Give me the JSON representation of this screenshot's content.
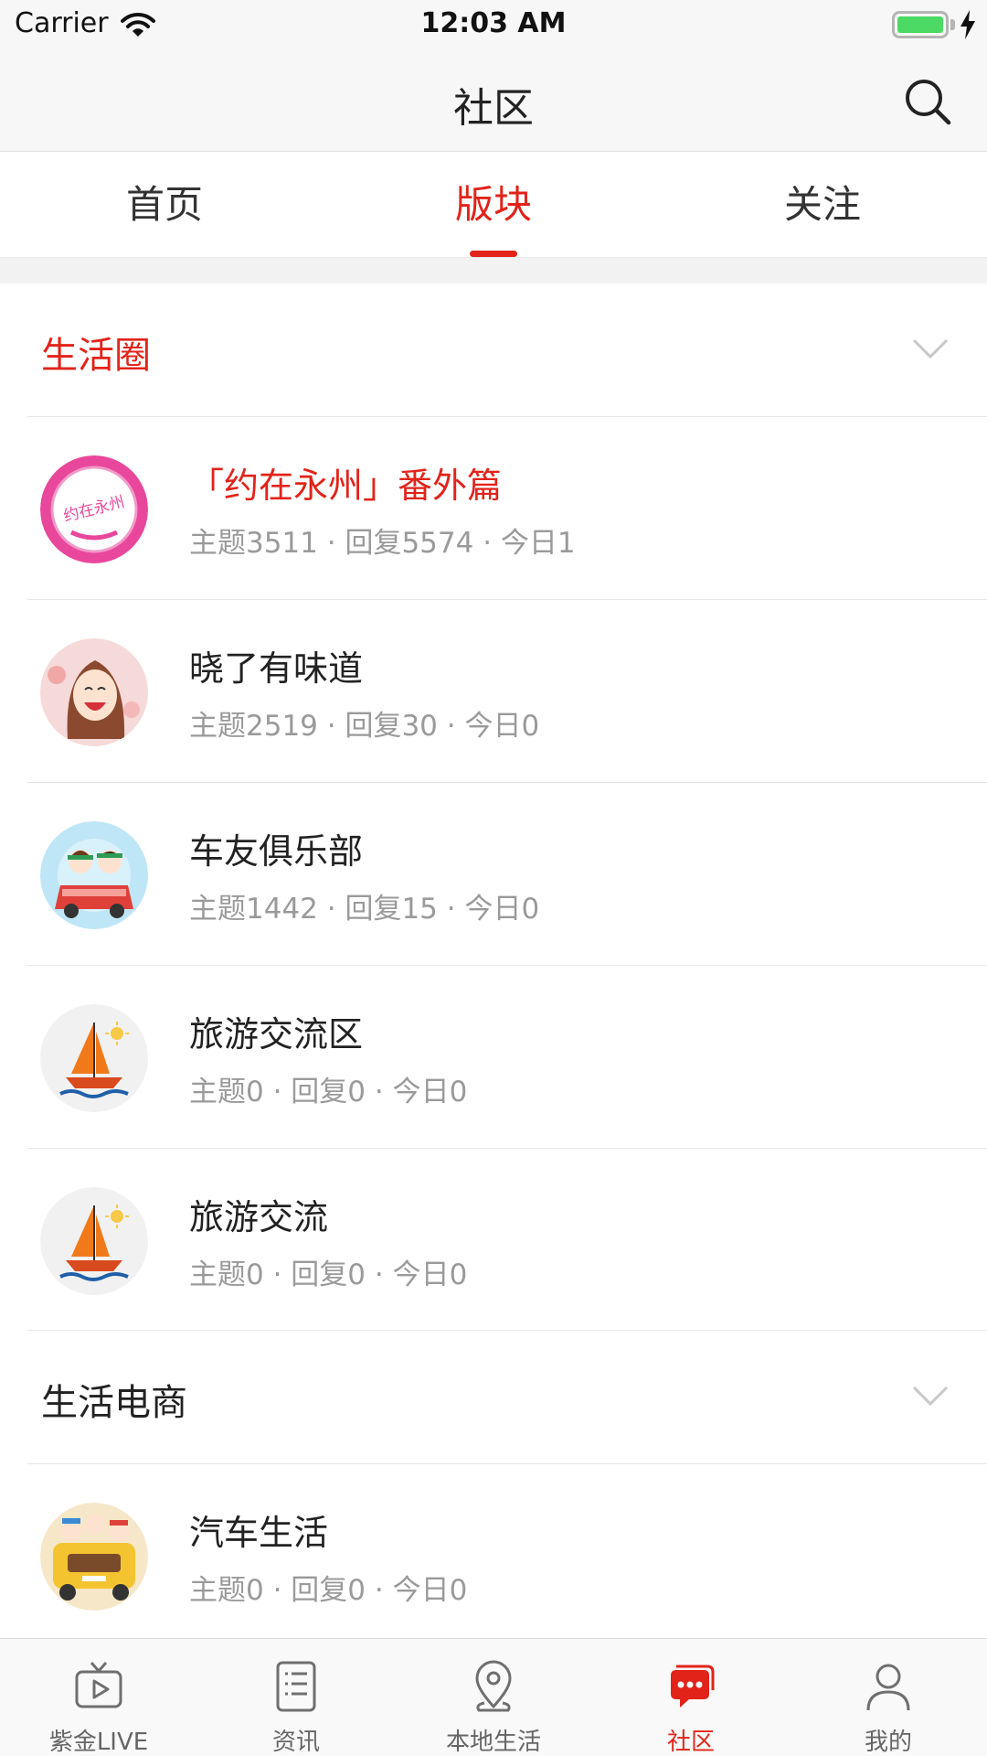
{
  "status_bar": {
    "carrier": "Carrier",
    "time": "12:03 AM"
  },
  "nav": {
    "title": "社区",
    "search_icon": "search-icon"
  },
  "tabs": [
    {
      "label": "首页",
      "active": false
    },
    {
      "label": "版块",
      "active": true
    },
    {
      "label": "关注",
      "active": false
    }
  ],
  "sections": [
    {
      "title": "生活圈",
      "title_color": "#e2231a",
      "items": [
        {
          "title": "「约在永州」番外篇",
          "meta": "主题3511 · 回复5574 · 今日1",
          "highlight": true,
          "avatar_text": "约在永州"
        },
        {
          "title": "晓了有味道",
          "meta": "主题2519 · 回复30 · 今日0"
        },
        {
          "title": "车友俱乐部",
          "meta": "主题1442 · 回复15 · 今日0"
        },
        {
          "title": "旅游交流区",
          "meta": "主题0 · 回复0 · 今日0"
        },
        {
          "title": "旅游交流",
          "meta": "主题0 · 回复0 · 今日0"
        }
      ]
    },
    {
      "title": "生活电商",
      "title_color": "#222222",
      "items": [
        {
          "title": "汽车生活",
          "meta": "主题0 · 回复0 · 今日0"
        }
      ]
    }
  ],
  "tabbar": [
    {
      "label": "紫金LIVE",
      "icon": "tv-icon",
      "active": false
    },
    {
      "label": "资讯",
      "icon": "news-icon",
      "active": false
    },
    {
      "label": "本地生活",
      "icon": "location-icon",
      "active": false
    },
    {
      "label": "社区",
      "icon": "chat-icon",
      "active": true
    },
    {
      "label": "我的",
      "icon": "profile-icon",
      "active": false
    }
  ],
  "colors": {
    "accent": "#e2231a",
    "meta_text": "#9a9a9a",
    "battery": "#4cd964"
  }
}
